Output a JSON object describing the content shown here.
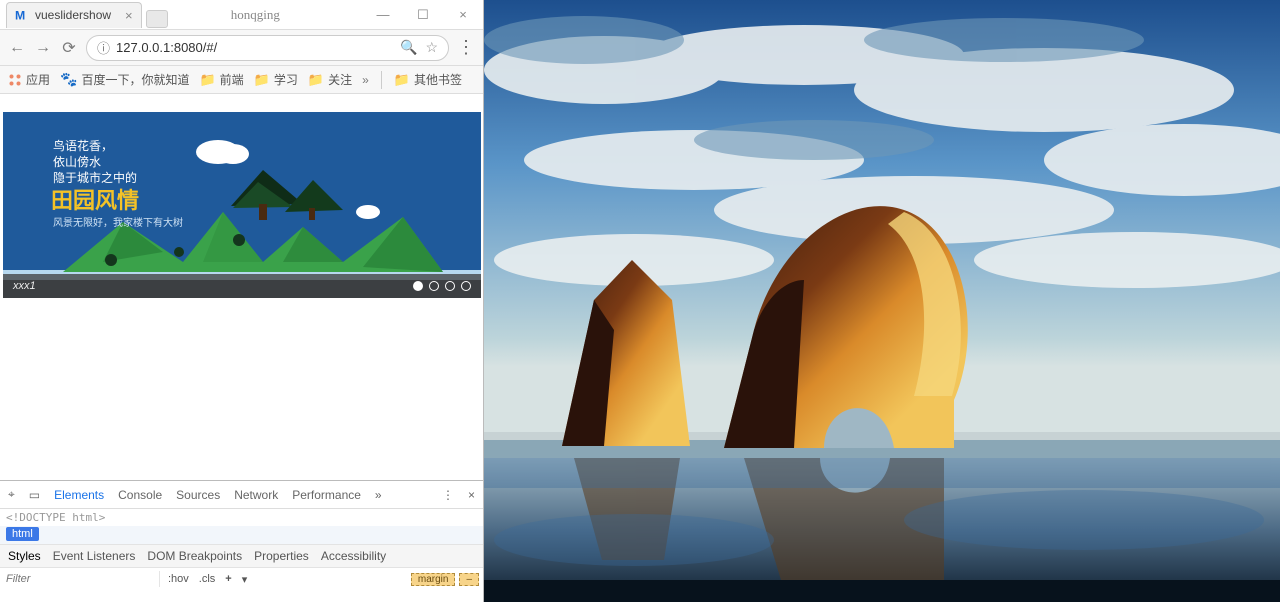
{
  "titlebar": {
    "tab_title": "vueslidershow",
    "user_label": "honqging"
  },
  "addressbar": {
    "url": "127.0.0.1:8080/#/"
  },
  "bookmarks": {
    "apps": "应用",
    "items": [
      "百度一下，你就知道",
      "前端",
      "学习",
      "关注"
    ],
    "overflow": "»",
    "other": "其他书签"
  },
  "slide": {
    "line1": "鸟语花香，",
    "line2": "依山傍水",
    "line3": "隐于城市之中的",
    "title": "田园风情",
    "sub": "风景无限好，我家楼下有大树",
    "caption": "xxx1"
  },
  "devtools": {
    "tabs": [
      "Elements",
      "Console",
      "Sources",
      "Network",
      "Performance"
    ],
    "overflow": "»",
    "dom_hint": "<!DOCTYPE html>",
    "crumb": "html",
    "panel_tabs": [
      "Styles",
      "Event Listeners",
      "DOM Breakpoints",
      "Properties",
      "Accessibility"
    ],
    "filter_placeholder": "Filter",
    "hov": ":hov",
    "cls": ".cls",
    "plus": "+",
    "boxmodel_label": "margin",
    "boxmodel_value": "–"
  }
}
